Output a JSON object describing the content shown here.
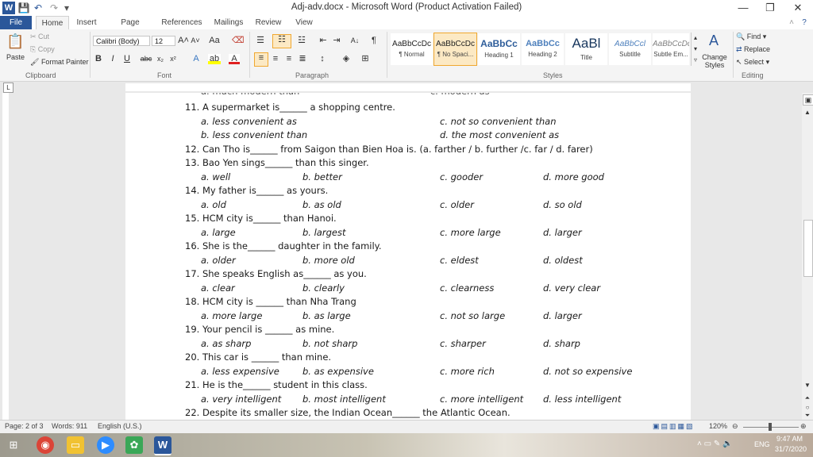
{
  "window": {
    "title": "Adj-adv.docx - Microsoft Word (Product Activation Failed)",
    "minimize": "—",
    "restore": "❐",
    "close": "✕"
  },
  "quick_access": {
    "word_icon": "W",
    "save": "💾",
    "undo": "↶",
    "redo": "↷",
    "more": "▾"
  },
  "tabs": [
    "File",
    "Home",
    "Insert",
    "Page Layout",
    "References",
    "Mailings",
    "Review",
    "View"
  ],
  "ribbon": {
    "clipboard": {
      "paste": "Paste",
      "cut": "Cut",
      "copy": "Copy",
      "format_painter": "Format Painter",
      "label": "Clipboard"
    },
    "font": {
      "name": "Calibri (Body)",
      "size": "12",
      "label": "Font"
    },
    "paragraph": {
      "label": "Paragraph"
    },
    "styles": {
      "label": "Styles",
      "items": [
        {
          "sample": "AaBbCcDc",
          "name": "¶ Normal"
        },
        {
          "sample": "AaBbCcDc",
          "name": "¶ No Spaci..."
        },
        {
          "sample": "AaBbCc",
          "name": "Heading 1"
        },
        {
          "sample": "AaBbCc",
          "name": "Heading 2"
        },
        {
          "sample": "AaBl",
          "name": "Title"
        },
        {
          "sample": "AaBbCcl",
          "name": "Subtitle"
        },
        {
          "sample": "AaBbCcDc",
          "name": "Subtle Em..."
        }
      ],
      "change_styles": "Change Styles"
    },
    "editing": {
      "find": "Find",
      "replace": "Replace",
      "select": "Select",
      "label": "Editing"
    }
  },
  "document": {
    "lines": [
      {
        "q": "11. A supermarket is______ a shopping centre.",
        "opts": []
      },
      {
        "q": "",
        "opts": [
          "a. less convenient as",
          "",
          "c. not so convenient than",
          ""
        ]
      },
      {
        "q": "",
        "opts": [
          "b. less convenient than",
          "",
          "d. the most convenient as",
          ""
        ]
      },
      {
        "q": "12. Can Tho is______ from Saigon than Bien Hoa is. (a. farther / b. further /c. far / d. farer)",
        "opts": []
      },
      {
        "q": "13. Bao Yen sings______ than this singer.",
        "opts": []
      },
      {
        "q": "",
        "opts": [
          "a. well",
          "b. better",
          "c. gooder",
          "d. more good"
        ]
      },
      {
        "q": "14. My father is______ as yours.",
        "opts": []
      },
      {
        "q": "",
        "opts": [
          "a. old",
          "b. as old",
          "c. older",
          "d. so old"
        ]
      },
      {
        "q": "15. HCM city is______ than Hanoi.",
        "opts": []
      },
      {
        "q": "",
        "opts": [
          "a. large",
          "b. largest",
          "c. more large",
          "d. larger"
        ]
      },
      {
        "q": "16. She is the______ daughter in the family.",
        "opts": []
      },
      {
        "q": "",
        "opts": [
          "a. older",
          "b. more old",
          "c. eldest",
          "d. oldest"
        ]
      },
      {
        "q": "17. She speaks English as______ as you.",
        "opts": []
      },
      {
        "q": "",
        "opts": [
          "a. clear",
          "b. clearly",
          "c. clearness",
          "d. very clear"
        ]
      },
      {
        "q": "18. HCM city is ______ than Nha Trang",
        "opts": []
      },
      {
        "q": "",
        "opts": [
          "a. more large",
          "b. as large",
          "c. not so large",
          "d. larger"
        ]
      },
      {
        "q": "19. Your pencil is ______ as mine.",
        "opts": []
      },
      {
        "q": "",
        "opts": [
          "a. as sharp",
          "b. not sharp",
          "c. sharper",
          "d. sharp"
        ]
      },
      {
        "q": "20. This car is ______ than mine.",
        "opts": []
      },
      {
        "q": "",
        "opts": [
          "a. less expensive",
          "b. as expensive",
          "c. more rich",
          "d. not so expensive"
        ]
      },
      {
        "q": "21. He is the______ student in this class.",
        "opts": []
      },
      {
        "q": "",
        "opts": [
          "a. very intelligent",
          "b. most intelligent",
          "c. more intelligent",
          "d. less intelligent"
        ]
      },
      {
        "q": "22. Despite its smaller size, the Indian Ocean______ the Atlantic Ocean.",
        "opts": []
      }
    ]
  },
  "status": {
    "page": "Page: 2 of 3",
    "words": "Words: 911",
    "language": "English (U.S.)",
    "zoom": "120%"
  },
  "taskbar": {
    "language": "ENG",
    "time": "9:47 AM",
    "date": "31/7/2020"
  },
  "colors": {
    "word_blue": "#2b579a",
    "selected_style": "#fce9c4",
    "ribbon_bg": "#f4f4f4"
  }
}
